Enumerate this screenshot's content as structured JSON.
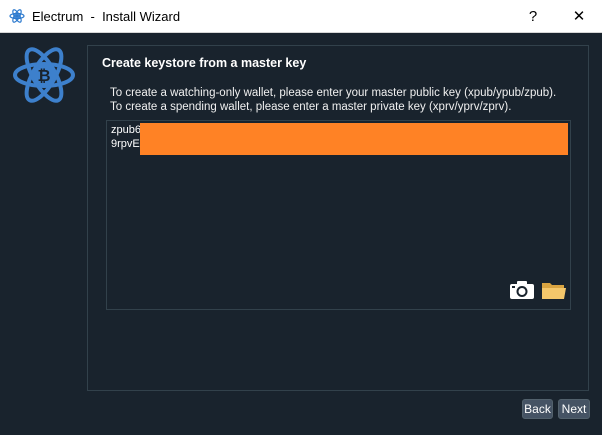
{
  "window": {
    "title": "Electrum  -  Install Wizard",
    "help_label": "?",
    "close_label": "✕"
  },
  "panel": {
    "heading": "Create keystore from a master key",
    "instructions": "To create a watching-only wallet, please enter your master public key (xpub/ypub/zpub). To create a spending wallet, please enter a master private key (xprv/yprv/zprv).",
    "key_lines": [
      "zpub6",
      "9rpvE"
    ]
  },
  "icons": {
    "app": "electrum-logo-icon",
    "logo": "bitcoin-atom-icon",
    "camera": "camera-icon",
    "folder": "folder-icon"
  },
  "buttons": {
    "back": "Back",
    "next": "Next"
  },
  "colors": {
    "background": "#19232d",
    "border": "#32414b",
    "redaction": "#ff8225",
    "logo_blue": "#3d80cc",
    "button": "#455364"
  }
}
